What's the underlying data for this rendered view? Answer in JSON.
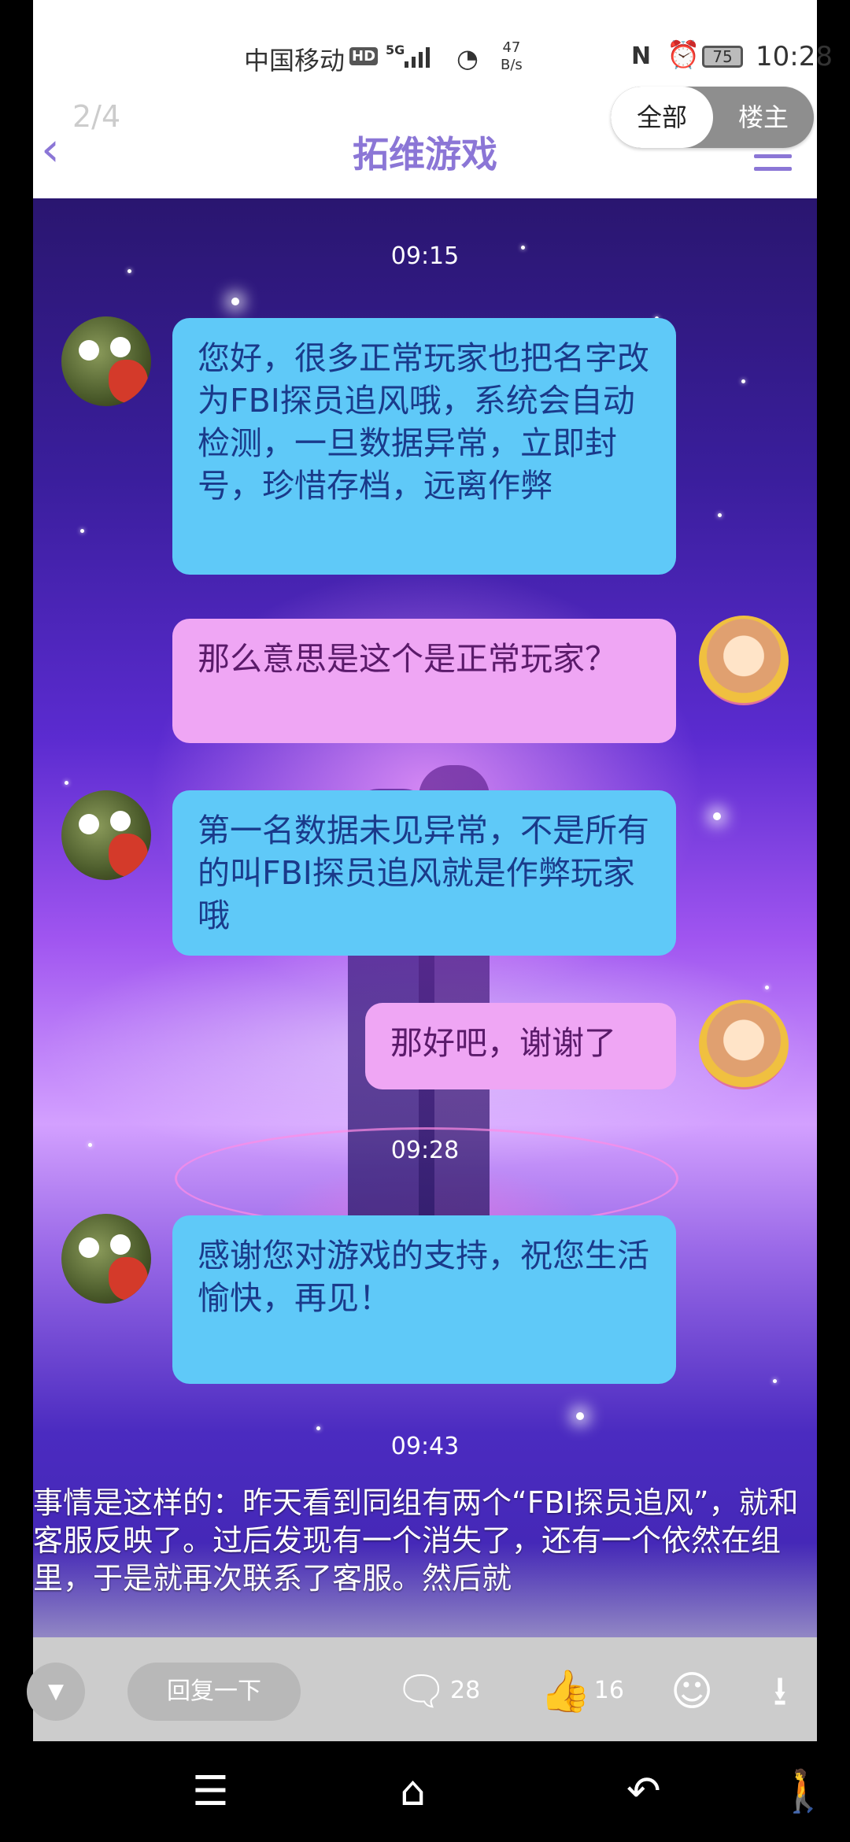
{
  "status_bar": {
    "carrier": "中国移动",
    "hd": "HD",
    "network": "5G",
    "speed_value": "47",
    "speed_unit": "B/s",
    "battery": "75",
    "time": "10:28"
  },
  "header": {
    "back_icon": "chevron-left-icon",
    "page_indicator": "2/4",
    "title": "拓维游戏",
    "menu_icon": "hamburger-icon"
  },
  "toggle": {
    "all_label": "全部",
    "owner_label": "楼主",
    "selected": "全部"
  },
  "chat": {
    "time_1": "09:15",
    "msg_1": "您好，很多正常玩家也把名字改为FBI探员追风哦，系统会自动检测，一旦数据异常，立即封号，珍惜存档，远离作弊",
    "msg_2": "那么意思是这个是正常玩家？",
    "msg_3": "第一名数据未见异常，不是所有的叫FBI探员追风就是作弊玩家哦",
    "msg_4": "那好吧，谢谢了",
    "time_2": "09:28",
    "msg_5": "感谢您对游戏的支持，祝您生活愉快，再见！",
    "time_3": "09:43"
  },
  "post_text": "事情是这样的：昨天看到同组有两个“FBI探员追风”，就和客服反映了。过后发现有一个消失了，还有一个依然在组里，于是就再次联系了客服。然后就",
  "toolbar": {
    "reply_placeholder": "回复一下",
    "comments_count": "28",
    "likes_count": "16"
  },
  "colors": {
    "accent": "#8b76d6",
    "bubble_blue": "#5fc9f8",
    "bubble_pink": "#efa6f4"
  }
}
